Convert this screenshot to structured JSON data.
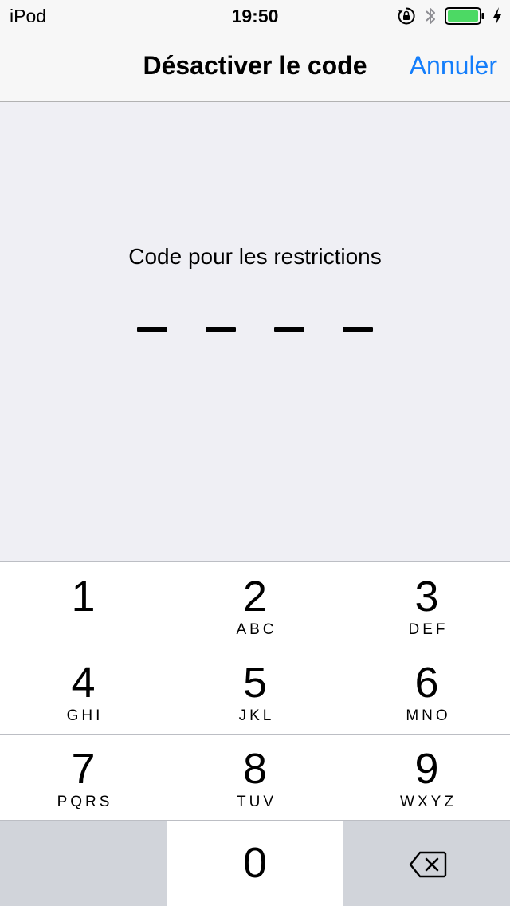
{
  "status_bar": {
    "carrier": "iPod",
    "time": "19:50",
    "icons": [
      "orientation-lock-icon",
      "bluetooth-icon",
      "battery-icon",
      "charging-bolt-icon"
    ],
    "battery_color": "#4cd964"
  },
  "nav": {
    "title": "Désactiver le code",
    "cancel_label": "Annuler",
    "accent_color": "#147efb"
  },
  "passcode": {
    "prompt": "Code pour les restrictions",
    "length": 4
  },
  "keypad": {
    "keys": [
      {
        "digit": "1",
        "letters": ""
      },
      {
        "digit": "2",
        "letters": "ABC"
      },
      {
        "digit": "3",
        "letters": "DEF"
      },
      {
        "digit": "4",
        "letters": "GHI"
      },
      {
        "digit": "5",
        "letters": "JKL"
      },
      {
        "digit": "6",
        "letters": "MNO"
      },
      {
        "digit": "7",
        "letters": "PQRS"
      },
      {
        "digit": "8",
        "letters": "TUV"
      },
      {
        "digit": "9",
        "letters": "WXYZ"
      },
      {
        "digit": "0",
        "letters": ""
      }
    ],
    "delete_icon": "delete-backspace-icon"
  }
}
